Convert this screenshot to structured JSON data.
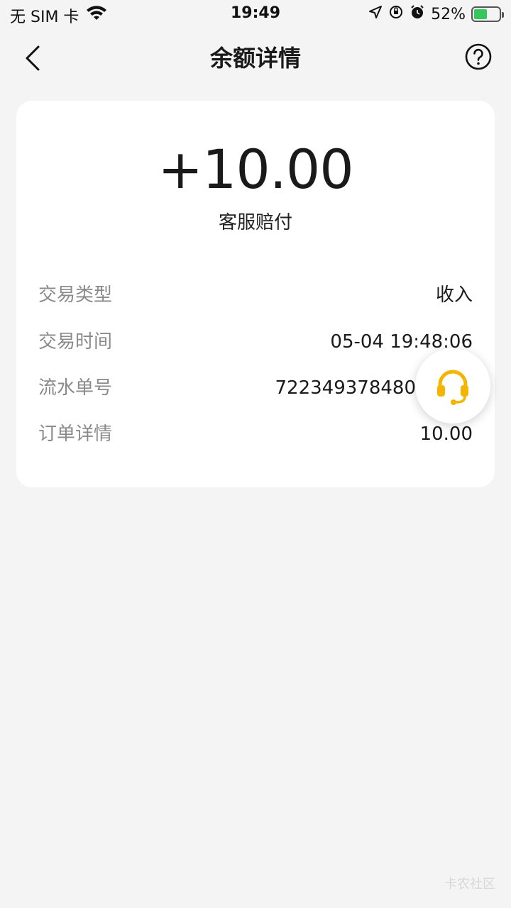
{
  "status_bar": {
    "carrier": "无 SIM 卡",
    "time": "19:49",
    "battery": "52%",
    "battery_level": 0.52
  },
  "nav": {
    "title": "余额详情"
  },
  "detail": {
    "amount": "+10.00",
    "description": "客服赔付",
    "rows": [
      {
        "label": "交易类型",
        "value": "收入"
      },
      {
        "label": "交易时间",
        "value": "05-04 19:48:06"
      },
      {
        "label": "流水单号",
        "value": "722349378480"
      },
      {
        "label": "订单详情",
        "value": "10.00"
      }
    ]
  },
  "watermark": "卡农社区",
  "colors": {
    "accent": "#f5b400",
    "background": "#f4f4f4",
    "card": "#ffffff"
  }
}
